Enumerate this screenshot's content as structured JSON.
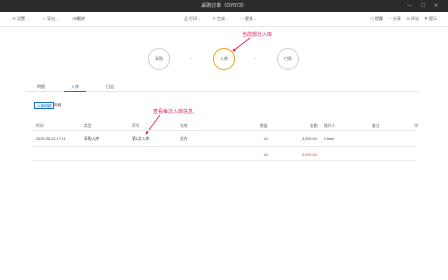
{
  "window": {
    "title": "采购订单（OY073）",
    "controls": [
      "—",
      "☐",
      "✕"
    ]
  },
  "toolbar": {
    "left": [
      {
        "icon": "☰",
        "label": "设置",
        "dropdown": true
      },
      {
        "icon": "⌂",
        "label": "导出",
        "dropdown": true
      },
      {
        "icon": "⌫",
        "label": "删除",
        "dropdown": false
      }
    ],
    "middle": [
      {
        "icon": "⎙",
        "label": "打印",
        "dropdown": true
      },
      {
        "icon": "↻",
        "label": "生成",
        "dropdown": true
      },
      {
        "icon": "⋯",
        "label": "更多",
        "dropdown": true
      }
    ],
    "right": [
      {
        "icon": "◷",
        "label": "提醒"
      },
      {
        "icon": "♡",
        "label": "分享"
      },
      {
        "icon": "✉",
        "label": "评论"
      },
      {
        "icon": "⚑",
        "label": "提示"
      }
    ]
  },
  "stages": [
    {
      "label": "采购",
      "active": false
    },
    {
      "label": "入库",
      "active": true
    },
    {
      "label": "付款",
      "active": false
    }
  ],
  "annotations": {
    "stage_note": "当前部分入库",
    "table_note": "查看每次入库信息"
  },
  "tabs": [
    {
      "label": "明细",
      "active": false
    },
    {
      "label": "入库",
      "active": true
    },
    {
      "label": "日志",
      "active": false
    }
  ],
  "subfilters": [
    {
      "label": "入库明细",
      "active": true
    },
    {
      "label": "明细",
      "active": false
    }
  ],
  "table": {
    "headers": [
      "时间",
      "类型",
      "序号",
      "仓库",
      "数量",
      "金额",
      "操作人",
      "备注"
    ],
    "rows": [
      {
        "time": "2025-05-23 17:11",
        "type": "采购入库",
        "seq": "第1次入库",
        "warehouse": "总仓",
        "qty": "60",
        "amount": "3,000.00",
        "operator": "Cheer",
        "note": ""
      }
    ],
    "totals": {
      "qty": "60",
      "amount": "3,000.00"
    }
  }
}
